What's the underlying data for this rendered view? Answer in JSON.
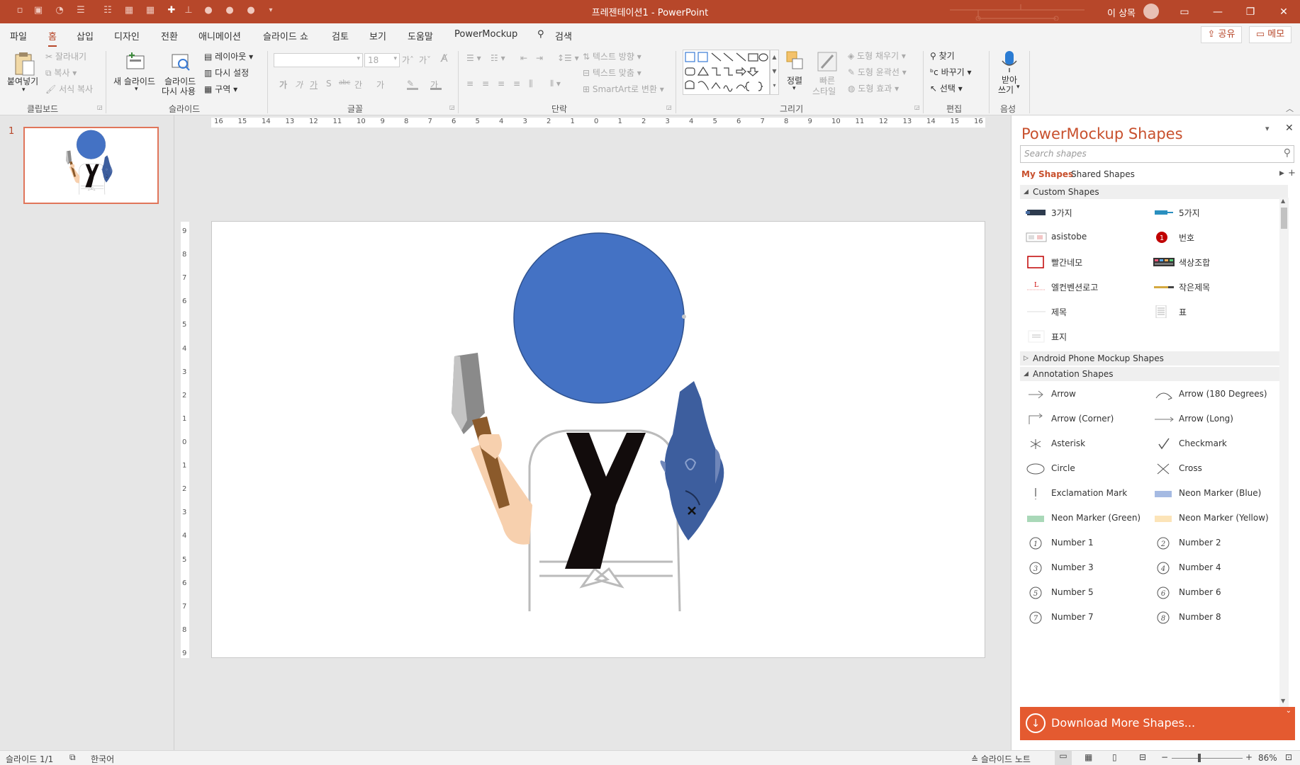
{
  "app": {
    "doc_title": "프레젠테이션1  -  PowerPoint",
    "user_name": "이 상목"
  },
  "menu": {
    "tabs": [
      "파일",
      "홈",
      "삽입",
      "디자인",
      "전환",
      "애니메이션",
      "슬라이드 쇼",
      "검토",
      "보기",
      "도움말",
      "PowerMockup"
    ],
    "active": "홈",
    "search_label": "검색",
    "share": "공유",
    "memo": "메모"
  },
  "ribbon": {
    "clipboard": {
      "label": "클립보드",
      "paste": "붙여넣기",
      "cut": "잘라내기",
      "copy": "복사",
      "format_painter": "서식 복사"
    },
    "slides": {
      "label": "슬라이드",
      "new_slide": "새 슬라이드",
      "reuse1": "슬라이드",
      "reuse2": "다시 사용",
      "layout": "레이아웃",
      "reset": "다시 설정",
      "section": "구역"
    },
    "font": {
      "label": "글꼴",
      "size": "18",
      "font_name": "",
      "bold": "가",
      "italic": "가",
      "underline": "가",
      "shadow": "S",
      "strike": "abc",
      "spacing": "간",
      "case": "가"
    },
    "paragraph": {
      "label": "단락",
      "text_direction": "텍스트 방향",
      "align_text": "텍스트 맞춤",
      "smartart": "SmartArt로 변환"
    },
    "drawing": {
      "label": "그리기",
      "arrange": "정렬",
      "quick_styles1": "빠른",
      "quick_styles2": "스타일",
      "fill": "도형 채우기",
      "outline": "도형 윤곽선",
      "effects": "도형 효과"
    },
    "editing": {
      "label": "편집",
      "find": "찾기",
      "replace": "바꾸기",
      "select": "선택"
    },
    "voice": {
      "label": "음성",
      "dictate1": "받아",
      "dictate2": "쓰기"
    }
  },
  "slide_panel": {
    "number": "1"
  },
  "rulers": {
    "h_ticks": [
      "16",
      "15",
      "14",
      "13",
      "12",
      "11",
      "10",
      "9",
      "8",
      "7",
      "6",
      "5",
      "4",
      "3",
      "2",
      "1",
      "0",
      "1",
      "2",
      "3",
      "4",
      "5",
      "6",
      "7",
      "8",
      "9",
      "10",
      "11",
      "12",
      "13",
      "14",
      "15",
      "16"
    ],
    "v_ticks": [
      "9",
      "8",
      "7",
      "6",
      "5",
      "4",
      "3",
      "2",
      "1",
      "0",
      "1",
      "2",
      "3",
      "4",
      "5",
      "6",
      "7",
      "8",
      "9"
    ]
  },
  "pm": {
    "title": "PowerMockup Shapes",
    "search_placeholder": "Search shapes",
    "tab_my": "My Shapes",
    "tab_shared": "Shared Shapes",
    "custom_header": "Custom Shapes",
    "custom": [
      "3가지",
      "5가지",
      "asistobe",
      "번호",
      "빨간네모",
      "색상조합",
      "엘컨벤션로고",
      "작은제목",
      "제목",
      "표",
      "표지"
    ],
    "android_header": "Android Phone Mockup Shapes",
    "annotation_header": "Annotation Shapes",
    "annotation": [
      "Arrow",
      "Arrow (180 Degrees)",
      "Arrow (Corner)",
      "Arrow (Long)",
      "Asterisk",
      "Checkmark",
      "Circle",
      "Cross",
      "Exclamation Mark",
      "Neon Marker (Blue)",
      "Neon Marker (Green)",
      "Neon Marker (Yellow)",
      "Number 1",
      "Number 2",
      "Number 3",
      "Number 4",
      "Number 5",
      "Number 6",
      "Number 7",
      "Number 8"
    ],
    "download": "Download More Shapes..."
  },
  "status": {
    "slide": "슬라이드 1/1",
    "lang": "한국어",
    "notes": "슬라이드 노트",
    "zoom": "86%"
  },
  "colors": {
    "accent": "#b7472a",
    "circle": "#4472c4",
    "download": "#e45a30"
  }
}
